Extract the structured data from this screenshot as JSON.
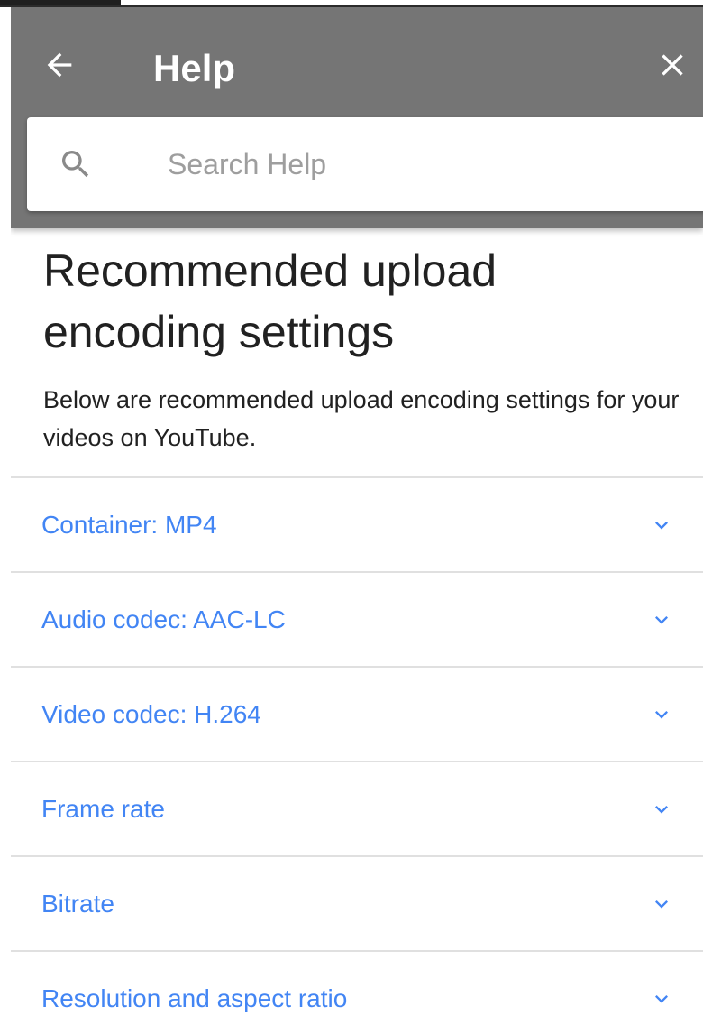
{
  "header": {
    "title": "Help",
    "background_color": "#757575",
    "back_icon": "arrow-back-icon",
    "close_icon": "close-icon"
  },
  "search": {
    "placeholder": "Search Help",
    "value": "",
    "icon": "search-icon"
  },
  "article": {
    "title": "Recommended upload encoding settings",
    "description": "Below are recommended upload encoding settings for your videos on YouTube."
  },
  "accordion": {
    "link_color": "#4285f4",
    "expand_icon": "chevron-down-icon",
    "items": [
      {
        "label": "Container: MP4"
      },
      {
        "label": "Audio codec: AAC-LC"
      },
      {
        "label": "Video codec: H.264"
      },
      {
        "label": "Frame rate"
      },
      {
        "label": "Bitrate"
      },
      {
        "label": "Resolution and aspect ratio"
      }
    ]
  }
}
